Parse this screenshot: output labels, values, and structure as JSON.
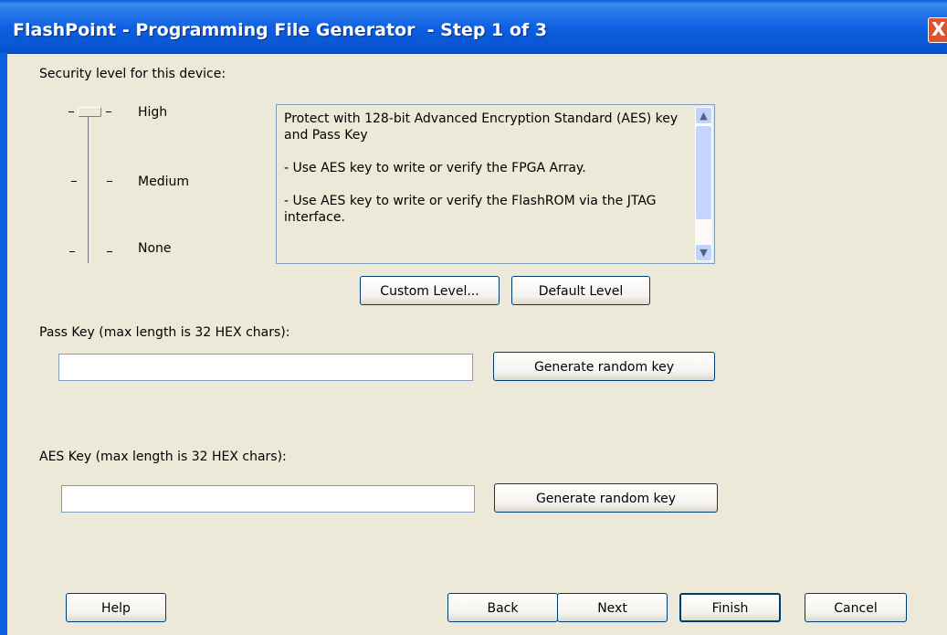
{
  "window": {
    "title": "FlashPoint - Programming File Generator  - Step 1 of 3",
    "close_label": "X"
  },
  "security": {
    "heading": "Security level for this device:",
    "levels": [
      "High",
      "Medium",
      "None"
    ],
    "selected_level": "High",
    "description": [
      "Protect with 128-bit Advanced Encryption Standard (AES) key and Pass Key",
      "- Use AES key to write or verify the FPGA Array.",
      "- Use AES key to write or verify the FlashROM via the JTAG interface."
    ],
    "custom_level_label": "Custom Level...",
    "default_level_label": "Default Level"
  },
  "pass_key": {
    "label": "Pass Key (max length is 32 HEX chars):",
    "value": "",
    "generate_label": "Generate random key"
  },
  "aes_key": {
    "label": "AES Key (max length is 32 HEX chars):",
    "value": "",
    "generate_label": "Generate random key"
  },
  "footer": {
    "help_label": "Help",
    "back_label": "Back",
    "next_label": "Next",
    "finish_label": "Finish",
    "cancel_label": "Cancel"
  },
  "icons": {
    "close": "close-icon",
    "scroll_up": "chevron-up-icon",
    "scroll_down": "chevron-down-icon"
  },
  "colors": {
    "titlebar": "#0b5fe0",
    "close": "#e0542c",
    "dialog": "#ece9d8"
  }
}
